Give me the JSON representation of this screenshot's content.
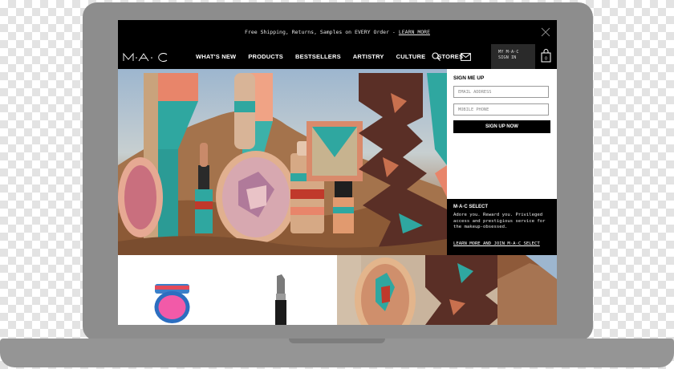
{
  "promo": {
    "text": "Free Shipping, Returns, Samples on EVERY Order -",
    "link": "LEARN MORE"
  },
  "brand": {
    "logo_text": "M·A·C"
  },
  "nav": {
    "items": [
      "WHAT'S NEW",
      "PRODUCTS",
      "BESTSELLERS",
      "ARTISTRY",
      "CULTURE",
      "STORES"
    ],
    "signin_line1": "MY M·A·C",
    "signin_line2": "SIGN IN",
    "bag_count": "0"
  },
  "signup": {
    "title": "SIGN ME UP",
    "email_placeholder": "EMAIL ADDRESS",
    "phone_placeholder": "MOBILE PHONE",
    "button": "SIGN UP NOW"
  },
  "mac_select": {
    "title": "M·A·C SELECT",
    "text": "Adore you. Reward you. Privileged access and prestigious service for the makeup-obsessed.",
    "link": "LEARN MORE AND JOIN M·A·C SELECT"
  },
  "icons": {
    "close": "close-icon",
    "search": "search-icon",
    "mail": "mail-icon",
    "bag": "shopping-bag-icon"
  },
  "colors": {
    "frame": "#8d8d8d",
    "bar": "#000000",
    "accent_teal": "#2fa7a0",
    "accent_coral": "#e8856a",
    "accent_pink": "#f25aa8",
    "accent_brown": "#5a2f26"
  }
}
